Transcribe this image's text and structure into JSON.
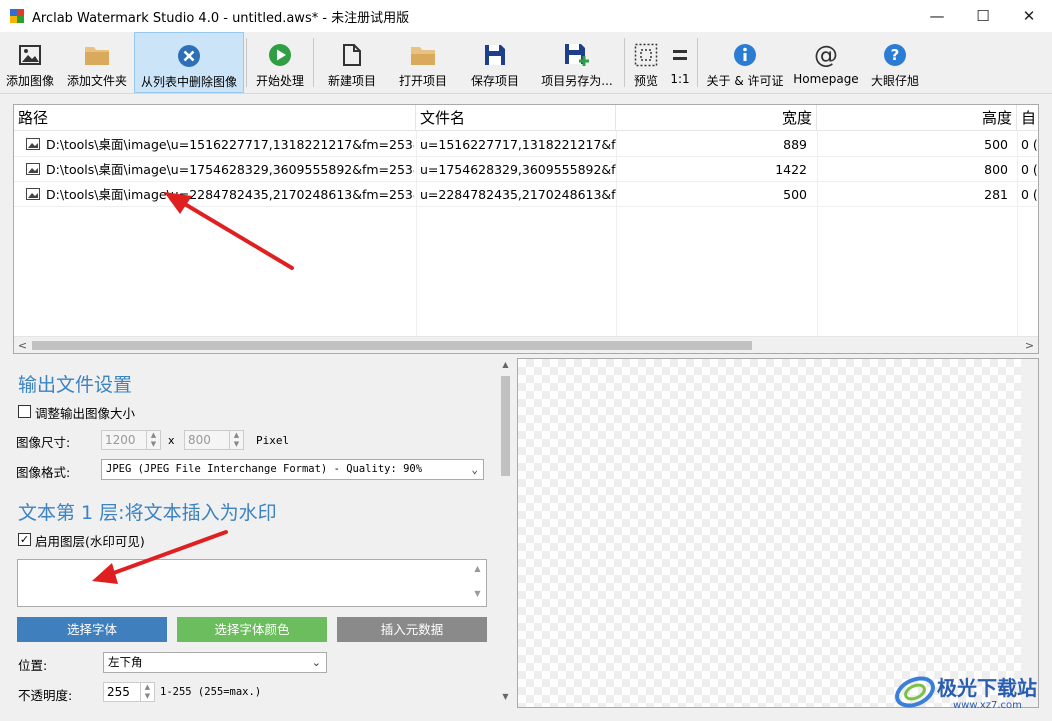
{
  "window": {
    "title": "Arclab Watermark Studio 4.0 - untitled.aws* - 未注册试用版",
    "controls": {
      "minimize": "—",
      "maximize": "☐",
      "close": "✕"
    }
  },
  "toolbar": {
    "add_image": "添加图像",
    "add_folder": "添加文件夹",
    "remove_image": "从列表中删除图像",
    "start": "开始处理",
    "new_project": "新建项目",
    "open_project": "打开项目",
    "save_project": "保存项目",
    "save_as": "项目另存为...",
    "preview": "预览",
    "ratio": "1:1",
    "about": "关于 & 许可证",
    "homepage": "Homepage",
    "bigeye": "大眼仔旭"
  },
  "file_list": {
    "columns": {
      "path": "路径",
      "filename": "文件名",
      "width": "宽度",
      "height": "高度",
      "extra": "自"
    },
    "rows": [
      {
        "path": "D:\\tools\\桌面\\image\\u=1516227717,1318221217&fm=253&f...",
        "filename": "u=1516227717,1318221217&f...",
        "width": "889",
        "height": "500",
        "extra": "0 ("
      },
      {
        "path": "D:\\tools\\桌面\\image\\u=1754628329,3609555892&fm=253&f...",
        "filename": "u=1754628329,3609555892&f...",
        "width": "1422",
        "height": "800",
        "extra": "0 ("
      },
      {
        "path": "D:\\tools\\桌面\\image\\u=2284782435,2170248613&fm=253&f...",
        "filename": "u=2284782435,2170248613&f...",
        "width": "500",
        "height": "281",
        "extra": "0 ("
      }
    ]
  },
  "output": {
    "title": "输出文件设置",
    "resize_label": "调整输出图像大小",
    "size_label": "图像尺寸:",
    "width_value": "1200",
    "x": "x",
    "height_value": "800",
    "unit": "Pixel",
    "format_label": "图像格式:",
    "format_value": "JPEG (JPEG File Interchange Format) - Quality: 90%"
  },
  "text_layer": {
    "title": "文本第 1 层:将文本插入为水印",
    "enable_label": "启用图层(水印可见)",
    "enable_check": "✓",
    "choose_font": "选择字体",
    "choose_color": "选择字体颜色",
    "insert_meta": "插入元数据",
    "position_label": "位置:",
    "position_value": "左下角",
    "opacity_label": "不透明度:",
    "opacity_value": "255",
    "opacity_range": "1-255 (255=max.)"
  },
  "watermark": {
    "name": "极光下载站",
    "url": "www.xz7.com"
  },
  "colors": {
    "accent_title": "#3b83c3",
    "btn_blue": "#3f7fbd",
    "btn_green": "#6cbd5e",
    "btn_gray": "#8a8a8a",
    "arrow": "#e02020"
  }
}
